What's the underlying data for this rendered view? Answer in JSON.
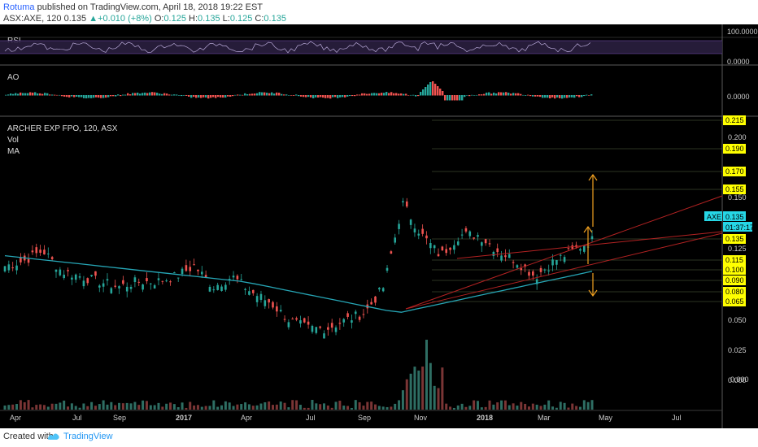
{
  "header": {
    "author": "Rotuma",
    "published_text": " published on ",
    "site": "TradingView.com",
    "date_text": ", April 18, 2018 19:22 EST",
    "symbol": "ASX:AXE, 120",
    "price": "0.135",
    "change_icon": "triangle-up-icon",
    "change": "+0.010 (+8%)",
    "o_label": "O:",
    "o_val": "0.125",
    "h_label": "H:",
    "h_val": "0.135",
    "l_label": "L:",
    "l_val": "0.125",
    "c_label": "C:",
    "c_val": "0.135"
  },
  "panes": {
    "rsi": {
      "label": "RSI",
      "scale": [
        "100.0000",
        "0.0000"
      ]
    },
    "ao": {
      "label": "AO",
      "scale": [
        "0.0000"
      ]
    },
    "main": {
      "title": "ARCHER EXP FPO, 120, ASX",
      "legend": [
        "Vol",
        "MA"
      ],
      "last_price_label": "0.135",
      "symbol_tag": "AXE",
      "countdown": "01:37:17",
      "vol_scale": "0.000"
    }
  },
  "footer": {
    "created_with": "Created with",
    "brand": "TradingView"
  },
  "colors": {
    "background": "#000000",
    "ma_line": "#26a6b6",
    "trend_line": "#b22222",
    "target_arrow": "#f0a020",
    "price_tag": "#ffff00",
    "last_price_tag": "#26d7e6",
    "up_candle": "#26a69a",
    "down_candle": "#ef5350"
  },
  "chart_data": {
    "type": "candlestick",
    "title": "ARCHER EXP FPO, 120, ASX",
    "y_ticks": [
      "0.215",
      "0.200",
      "0.190",
      "0.170",
      "0.155",
      "0.150",
      "0.135",
      "0.135",
      "0.125",
      "0.115",
      "0.100",
      "0.090",
      "0.080",
      "0.065",
      "0.050",
      "0.025",
      "0.000"
    ],
    "highlighted_levels": [
      "0.215",
      "0.190",
      "0.170",
      "0.155",
      "0.135",
      "0.115",
      "0.100",
      "0.090",
      "0.080",
      "0.065"
    ],
    "x_ticks": [
      "Apr",
      "Jul",
      "Sep",
      "2017",
      "Apr",
      "Jul",
      "Sep",
      "Nov",
      "2018",
      "Mar",
      "May",
      "Jul"
    ],
    "bold_x_ticks": [
      "2017",
      "2018"
    ],
    "price_path": [
      [
        "Apr",
        0.11
      ],
      [
        "",
        0.115
      ],
      [
        "",
        0.125
      ],
      [
        "Jul",
        0.105
      ],
      [
        "",
        0.1
      ],
      [
        "Sep",
        0.095
      ],
      [
        "",
        0.09
      ],
      [
        "",
        0.095
      ],
      [
        "2017",
        0.095
      ],
      [
        "",
        0.1
      ],
      [
        "",
        0.11
      ],
      [
        "Apr",
        0.09
      ],
      [
        "",
        0.1
      ],
      [
        "",
        0.085
      ],
      [
        "Jul",
        0.075
      ],
      [
        "",
        0.058
      ],
      [
        "",
        0.05
      ],
      [
        "Sep",
        0.05
      ],
      [
        "",
        0.058
      ],
      [
        "",
        0.065
      ],
      [
        "Nov",
        0.09
      ],
      [
        "",
        0.17
      ],
      [
        "",
        0.14
      ],
      [
        "",
        0.12
      ],
      [
        "",
        0.14
      ],
      [
        "2018",
        0.14
      ],
      [
        "",
        0.125
      ],
      [
        "",
        0.115
      ],
      [
        "Mar",
        0.1
      ],
      [
        "",
        0.115
      ],
      [
        "",
        0.125
      ],
      [
        "",
        0.135
      ]
    ]
  }
}
